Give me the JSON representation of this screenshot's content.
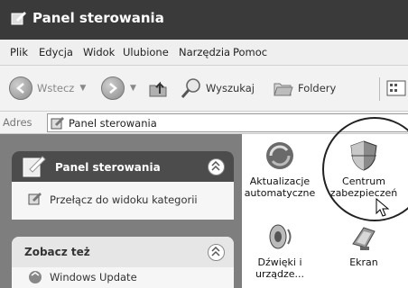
{
  "window": {
    "title": "Panel sterowania"
  },
  "menu": [
    "Plik",
    "Edycja",
    "Widok",
    "Ulubione",
    "Narzędzia",
    "Pomoc"
  ],
  "toolbar": {
    "back_label": "Wstecz",
    "search_label": "Wyszukaj",
    "folders_label": "Foldery"
  },
  "address": {
    "label": "Adres",
    "value": "Panel sterowania"
  },
  "sidebar": {
    "panel1": {
      "title": "Panel sterowania",
      "link": "Przełącz do widoku kategorii"
    },
    "panel2": {
      "title": "Zobacz też",
      "link": "Windows Update"
    }
  },
  "items": [
    {
      "label1": "Aktualizacje",
      "label2": "automatyczne"
    },
    {
      "label1": "Centrum",
      "label2": "zabezpieczeń"
    },
    {
      "label1": "Dźwięki i",
      "label2": "urządze..."
    },
    {
      "label1": "Ekran",
      "label2": ""
    }
  ]
}
